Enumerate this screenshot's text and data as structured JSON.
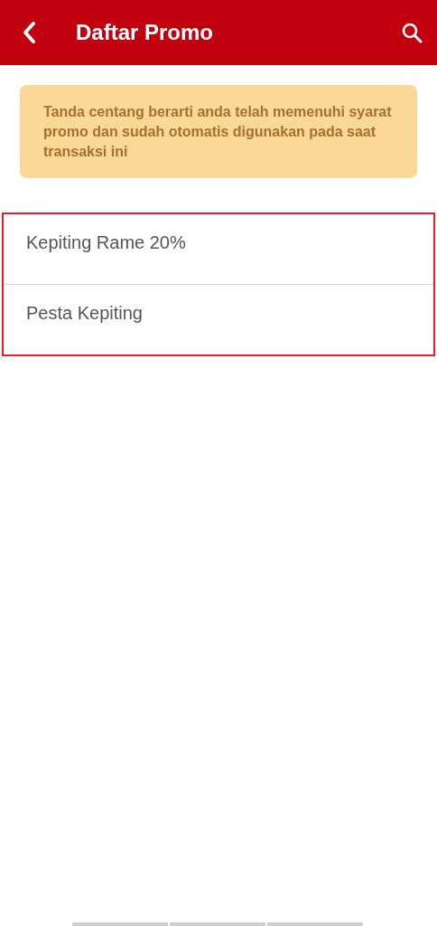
{
  "header": {
    "title": "Daftar Promo"
  },
  "notice": {
    "text": "Tanda centang berarti anda telah memenuhi syarat promo dan sudah otomatis digunakan pada saat transaksi ini"
  },
  "promos": [
    {
      "name": "Kepiting Rame 20%"
    },
    {
      "name": "Pesta Kepiting"
    }
  ]
}
